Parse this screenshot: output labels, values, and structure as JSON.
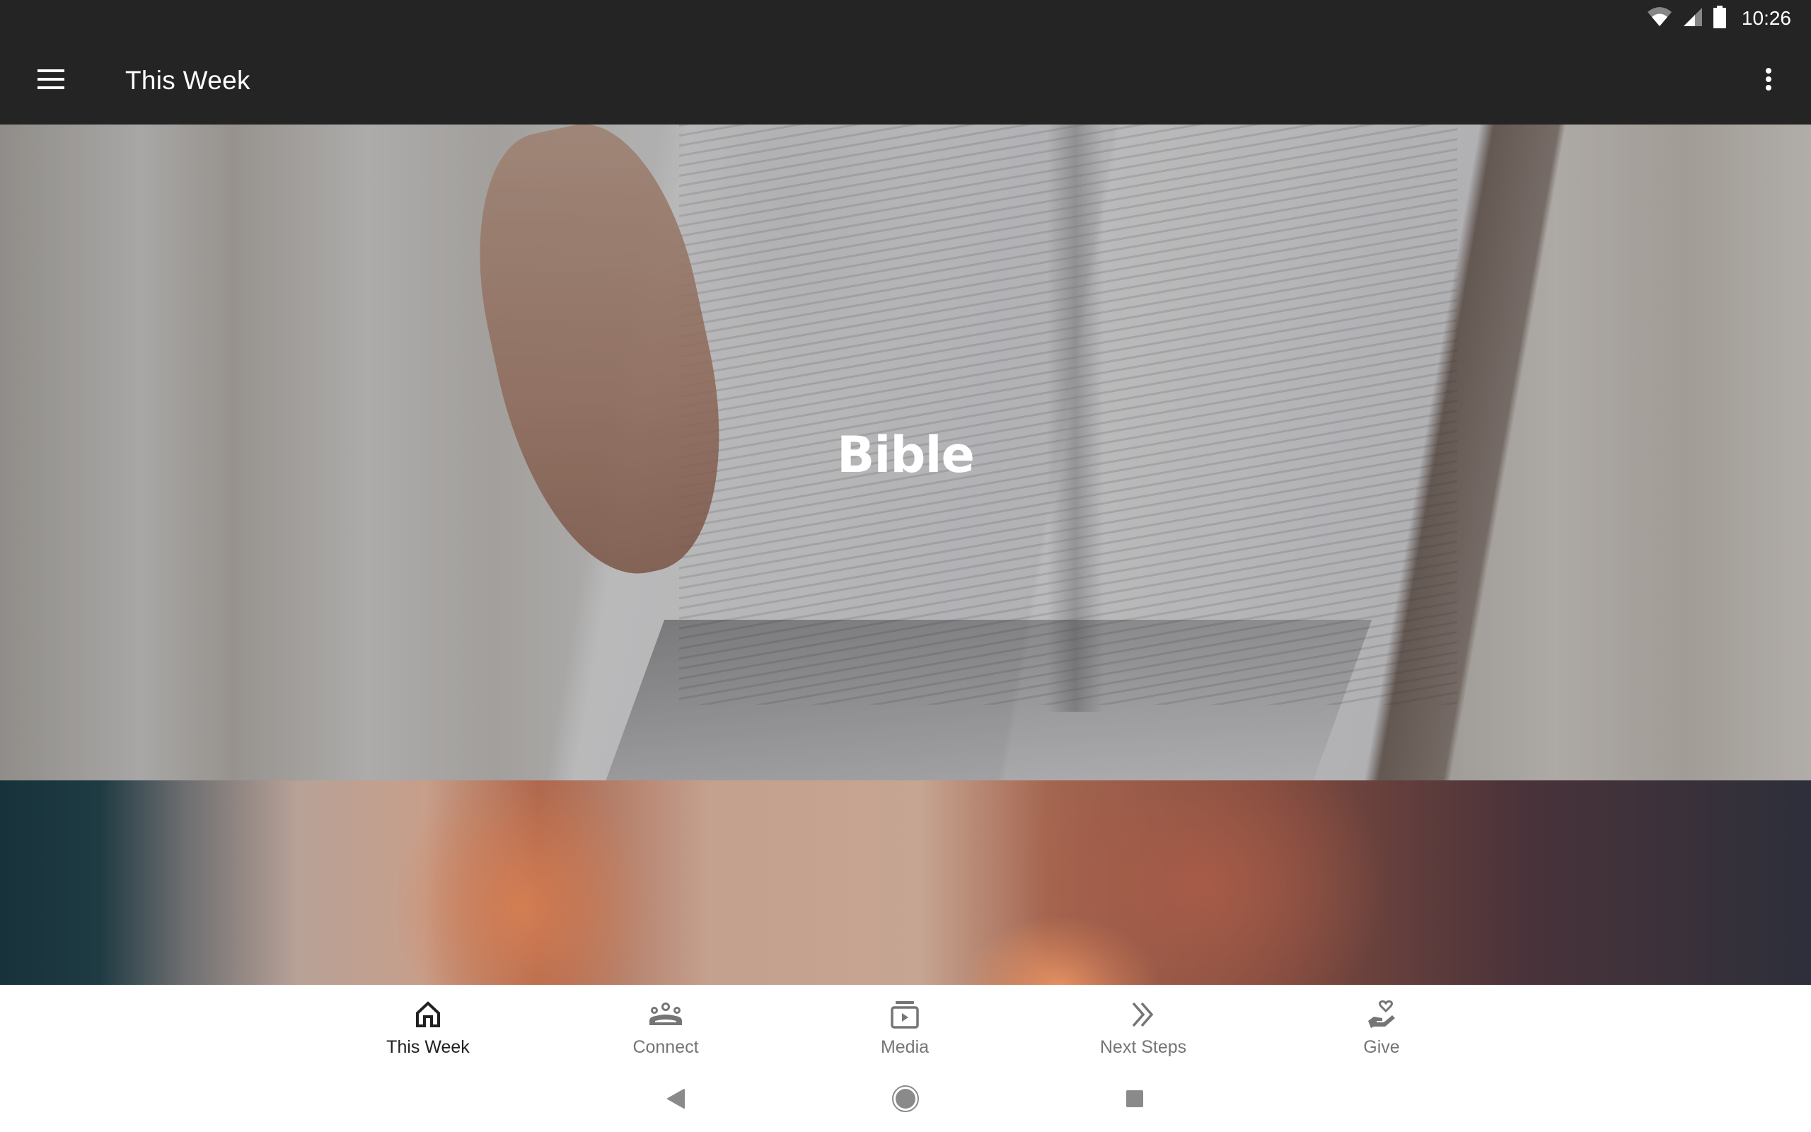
{
  "status_bar": {
    "time": "10:26",
    "icons": [
      "wifi-icon",
      "cellular-signal-icon",
      "battery-icon"
    ]
  },
  "app_bar": {
    "title": "This Week",
    "menu_icon": "hamburger-menu-icon",
    "overflow_icon": "more-vert-icon"
  },
  "feed": {
    "cards": [
      {
        "title": "Bible",
        "image": "open bible on blanket"
      },
      {
        "title": "",
        "image": "sunset clouds"
      }
    ]
  },
  "bottom_nav": {
    "active_color": "#212121",
    "inactive_color": "#757575",
    "items": [
      {
        "label": "This Week",
        "icon": "home-icon",
        "active": true
      },
      {
        "label": "Connect",
        "icon": "groups-icon",
        "active": false
      },
      {
        "label": "Media",
        "icon": "video-library-icon",
        "active": false
      },
      {
        "label": "Next Steps",
        "icon": "double-chevron-right-icon",
        "active": false
      },
      {
        "label": "Give",
        "icon": "volunteer-hand-heart-icon",
        "active": false
      }
    ]
  },
  "system_nav": {
    "buttons": [
      "back-icon",
      "home-circle-icon",
      "recents-square-icon"
    ]
  }
}
